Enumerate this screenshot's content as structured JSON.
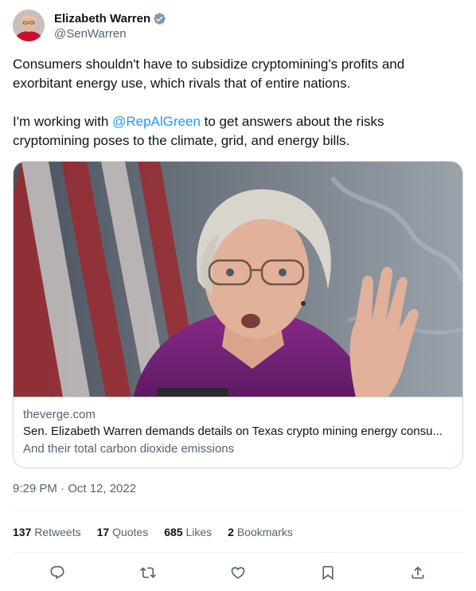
{
  "author": {
    "name": "Elizabeth Warren",
    "handle": "@SenWarren",
    "verified": true
  },
  "tweet": {
    "paragraph1": "Consumers shouldn't have to subsidize cryptomining's profits and exorbitant energy use, which rivals that of entire nations.",
    "paragraph2_before": "I'm working with ",
    "mention": "@RepAlGreen",
    "paragraph2_after": " to get answers about the risks cryptomining poses to the climate, grid, and energy bills."
  },
  "card": {
    "domain": "theverge.com",
    "title": "Sen. Elizabeth Warren demands details on Texas crypto mining energy consu...",
    "description": "And their total carbon dioxide emissions"
  },
  "timestamp": "9:29 PM · Oct 12, 2022",
  "stats": {
    "retweets_count": "137",
    "retweets_label": "Retweets",
    "quotes_count": "17",
    "quotes_label": "Quotes",
    "likes_count": "685",
    "likes_label": "Likes",
    "bookmarks_count": "2",
    "bookmarks_label": "Bookmarks"
  },
  "icons": {
    "reply": "reply-icon",
    "retweet": "retweet-icon",
    "like": "heart-icon",
    "bookmark": "bookmark-icon",
    "share": "share-icon",
    "verified": "verified-badge-icon"
  },
  "colors": {
    "text": "#0f1419",
    "secondary": "#536471",
    "accent": "#1d9bf0",
    "border": "#cfd9de"
  }
}
